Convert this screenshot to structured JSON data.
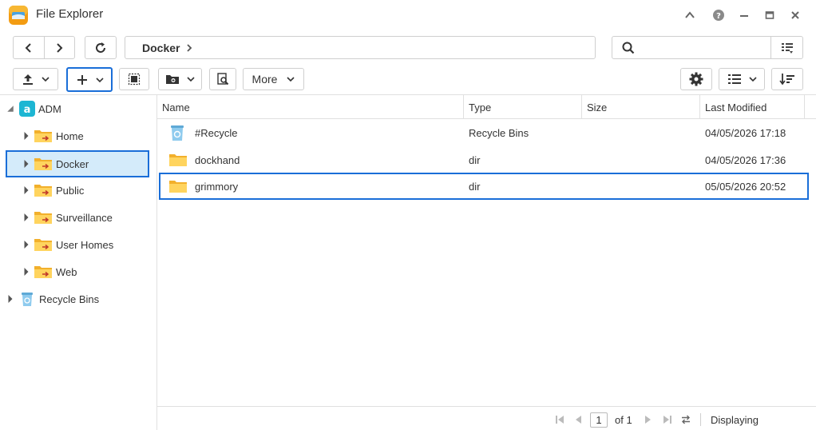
{
  "window": {
    "title": "File Explorer"
  },
  "toolbar": {
    "more_label": "More"
  },
  "path": {
    "segments": [
      "Docker"
    ]
  },
  "search": {
    "placeholder": ""
  },
  "tree": {
    "root": "ADM",
    "children": [
      "Home",
      "Docker",
      "Public",
      "Surveillance",
      "User Homes",
      "Web"
    ],
    "selected": "Docker",
    "recycle": "Recycle Bins"
  },
  "columns": [
    "Name",
    "Type",
    "Size",
    "Last Modified"
  ],
  "files": [
    {
      "name": "#Recycle",
      "type": "Recycle Bins",
      "size": "",
      "modified": "04/05/2026 17:18",
      "icon": "recycle-bin-icon"
    },
    {
      "name": "dockhand",
      "type": "dir",
      "size": "",
      "modified": "04/05/2026 17:36",
      "icon": "folder-icon"
    },
    {
      "name": "grimmory",
      "type": "dir",
      "size": "",
      "modified": "05/05/2026 20:52",
      "icon": "folder-icon"
    }
  ],
  "pager": {
    "page": "1",
    "of_label": "of 1",
    "status": "Displaying"
  },
  "colors": {
    "accent": "#1a6ed8",
    "selection": "#d4ebfa",
    "folder": "#f5c342"
  }
}
